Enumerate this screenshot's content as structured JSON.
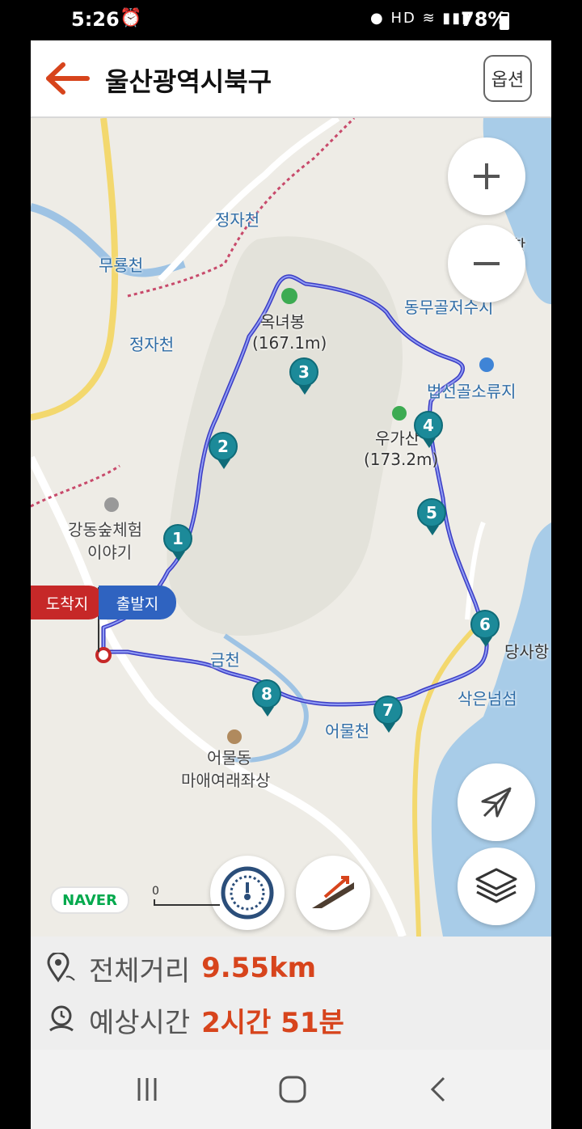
{
  "status_bar": {
    "time": "5:26",
    "network": "HD",
    "battery": "78%"
  },
  "header": {
    "title": "울산광역시북구",
    "option_label": "옵션"
  },
  "map": {
    "places": [
      {
        "id": "jeongjacheon-1",
        "label": "정자천"
      },
      {
        "id": "muryongcheon",
        "label": "무룡천"
      },
      {
        "id": "jeongjacheon-2",
        "label": "정자천"
      },
      {
        "id": "okryeobong",
        "label": "옥녀봉"
      },
      {
        "id": "okryeobong-height",
        "label": "(167.1m)"
      },
      {
        "id": "dongmugol-reservoir",
        "label": "동무골저수지"
      },
      {
        "id": "beopseongol",
        "label": "법선골소류지"
      },
      {
        "id": "ugasan",
        "label": "우가산"
      },
      {
        "id": "ugasan-height",
        "label": "(173.2m)"
      },
      {
        "id": "gangdong-forest",
        "label": "강동숲체험"
      },
      {
        "id": "gangdong-forest-2",
        "label": "이야기"
      },
      {
        "id": "geumcheon",
        "label": "금천"
      },
      {
        "id": "dangsahang",
        "label": "당사항"
      },
      {
        "id": "sageunneomseom",
        "label": "삭은넘섬"
      },
      {
        "id": "eomulcheon",
        "label": "어물천"
      },
      {
        "id": "eomuldong",
        "label": "어물동"
      },
      {
        "id": "maae",
        "label": "마애여래좌상"
      },
      {
        "id": "hang",
        "label": "항"
      }
    ],
    "waypoints": [
      "1",
      "2",
      "3",
      "4",
      "5",
      "6",
      "7",
      "8"
    ],
    "flag_end": "도착지",
    "flag_start": "출발지",
    "brand": "NAVER",
    "scale_label": "0",
    "route_color": "#3b3cc4",
    "pin_color": "#1c8a99"
  },
  "route_info": {
    "distance_label": "전체거리",
    "distance_value": "9.55km",
    "time_label": "예상시간",
    "time_value": "2시간 51분"
  },
  "icons": {
    "back": "arrow-left-icon",
    "zoom_in": "plus-icon",
    "zoom_out": "minus-icon",
    "compass": "compass-off-icon",
    "layers": "layers-icon",
    "speed": "speedometer-icon",
    "elevation": "elevation-icon",
    "distance": "location-pin-icon",
    "time": "clock-icon"
  }
}
